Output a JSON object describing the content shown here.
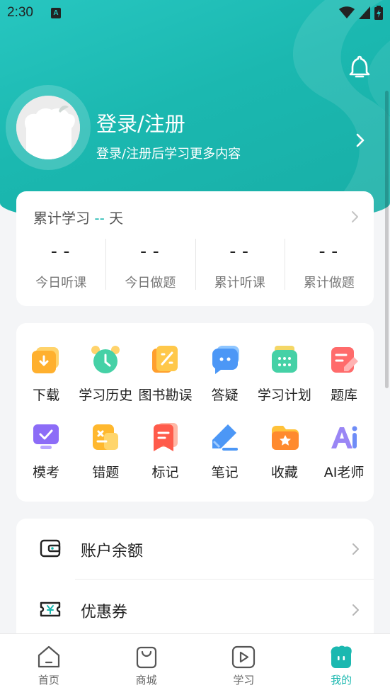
{
  "status_bar": {
    "time": "2:30",
    "notification_badge": "A"
  },
  "profile": {
    "title": "登录/注册",
    "subtitle": "登录/注册后学习更多内容"
  },
  "stats": {
    "head_prefix": "累计学习",
    "head_days": "--",
    "head_suffix": "天",
    "items": [
      {
        "value": "--",
        "label": "今日听课"
      },
      {
        "value": "--",
        "label": "今日做题"
      },
      {
        "value": "--",
        "label": "累计听课"
      },
      {
        "value": "--",
        "label": "累计做题"
      }
    ]
  },
  "features": [
    {
      "label": "下载",
      "icon": "download-icon"
    },
    {
      "label": "学习历史",
      "icon": "alarm-clock-icon"
    },
    {
      "label": "图书勘误",
      "icon": "book-errata-icon"
    },
    {
      "label": "答疑",
      "icon": "chat-bubble-icon"
    },
    {
      "label": "学习计划",
      "icon": "calendar-icon"
    },
    {
      "label": "题库",
      "icon": "question-bank-icon"
    },
    {
      "label": "模考",
      "icon": "monitor-check-icon"
    },
    {
      "label": "错题",
      "icon": "wrong-questions-icon"
    },
    {
      "label": "标记",
      "icon": "bookmark-icon"
    },
    {
      "label": "笔记",
      "icon": "pen-note-icon"
    },
    {
      "label": "收藏",
      "icon": "star-folder-icon"
    },
    {
      "label": "AI老师",
      "icon": "ai-icon"
    }
  ],
  "account_list": [
    {
      "label": "账户余额",
      "icon": "wallet-icon"
    },
    {
      "label": "优惠券",
      "icon": "coupon-icon"
    }
  ],
  "tabs": [
    {
      "label": "首页",
      "icon": "home-icon",
      "active": false
    },
    {
      "label": "商城",
      "icon": "shopping-bag-icon",
      "active": false
    },
    {
      "label": "学习",
      "icon": "play-icon",
      "active": false
    },
    {
      "label": "我的",
      "icon": "profile-face-icon",
      "active": true
    }
  ],
  "colors": {
    "accent": "#1bb8b0",
    "hero_start": "#27c6c0",
    "background": "#f4f5f7"
  }
}
